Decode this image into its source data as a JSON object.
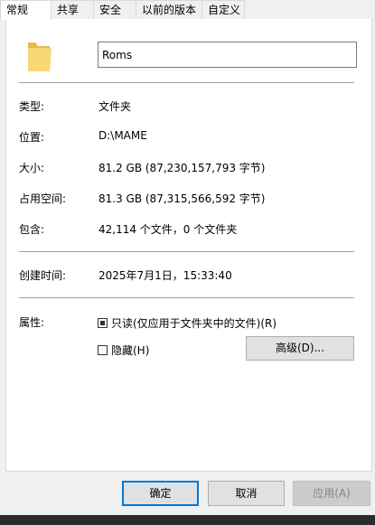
{
  "tabs": [
    {
      "label": "常规",
      "active": true
    },
    {
      "label": "共享",
      "active": false
    },
    {
      "label": "安全",
      "active": false
    },
    {
      "label": "以前的版本",
      "active": false
    },
    {
      "label": "自定义",
      "active": false
    }
  ],
  "folder": {
    "icon": "folder-icon",
    "name": "Roms"
  },
  "info": {
    "type_label": "类型:",
    "type_value": "文件夹",
    "location_label": "位置:",
    "location_value": "D:\\MAME",
    "size_label": "大小:",
    "size_value": "81.2 GB (87,230,157,793 字节)",
    "disk_label": "占用空间:",
    "disk_value": "81.3 GB (87,315,566,592 字节)",
    "contains_label": "包含:",
    "contains_value": "42,114 个文件，0 个文件夹",
    "created_label": "创建时间:",
    "created_value": "2025年7月1日，15:33:40"
  },
  "attributes": {
    "label": "属性:",
    "readonly_label": "只读(仅应用于文件夹中的文件)(R)",
    "readonly_state": "indeterminate",
    "hidden_label": "隐藏(H)",
    "hidden_state": "unchecked",
    "advanced_label": "高级(D)..."
  },
  "buttons": {
    "ok": "确定",
    "cancel": "取消",
    "apply": "应用(A)"
  },
  "colors": {
    "folder": "#f8d775",
    "accent": "#0078d7"
  }
}
